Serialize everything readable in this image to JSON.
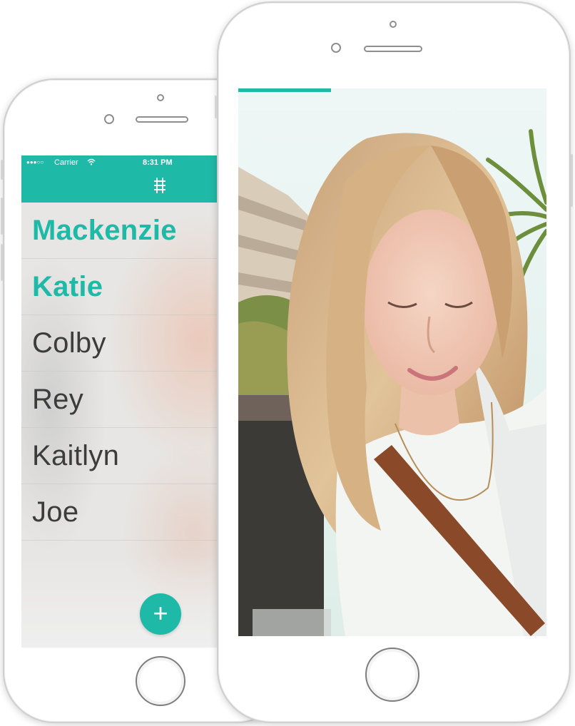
{
  "colors": {
    "accent": "#1fb9a7",
    "text": "#3c3c3c",
    "status_text": "#ffffff"
  },
  "left_phone": {
    "status_bar": {
      "signal": "●●●○○",
      "carrier": "Carrier",
      "wifi_icon": "wifi-icon",
      "time": "8:31 PM"
    },
    "nav_icon": "train-track-icon",
    "contacts": [
      {
        "name": "Mackenzie",
        "highlighted": true
      },
      {
        "name": "Katie",
        "highlighted": true
      },
      {
        "name": "Colby",
        "highlighted": false
      },
      {
        "name": "Rey",
        "highlighted": false
      },
      {
        "name": "Kaitlyn",
        "highlighted": false
      },
      {
        "name": "Joe",
        "highlighted": false
      }
    ],
    "add_button_label": "+"
  },
  "right_phone": {
    "progress": 0.3,
    "photo": "woman-with-long-blonde-hair-outdoors"
  }
}
